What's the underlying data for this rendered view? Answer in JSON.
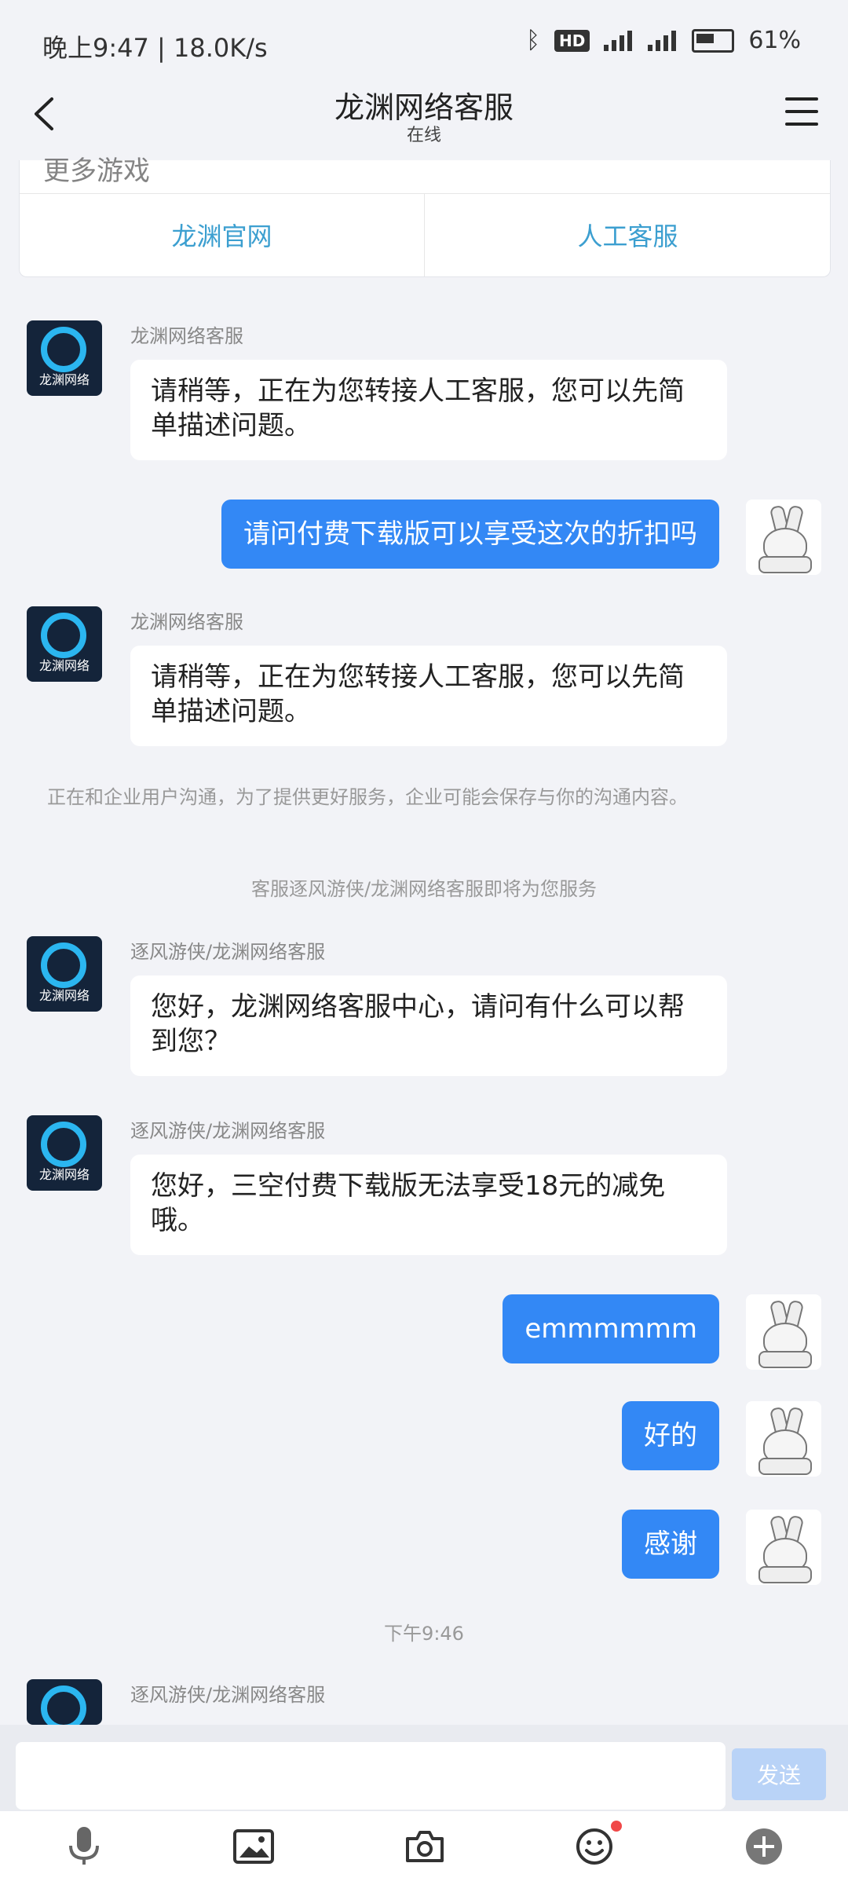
{
  "status_bar": {
    "time": "晚上9:47 | 18.0K/s",
    "hd": "HD",
    "battery": "61%"
  },
  "header": {
    "title": "龙渊网络客服",
    "subtitle": "在线"
  },
  "top_card": {
    "partial_text": "更多游戏",
    "btn_official": "龙渊官网",
    "btn_human": "人工客服"
  },
  "messages": {
    "m1": {
      "sender": "龙渊网络客服",
      "text": "请稍等，正在为您转接人工客服，您可以先简单描述问题。"
    },
    "u1": {
      "text": "请问付费下载版可以享受这次的折扣吗"
    },
    "m2": {
      "sender": "龙渊网络客服",
      "text": "请稍等，正在为您转接人工客服，您可以先简单描述问题。"
    },
    "note": "正在和企业用户沟通，为了提供更好服务，企业可能会保存与你的沟通内容。",
    "transfer": "客服逐风游侠/龙渊网络客服即将为您服务",
    "m3": {
      "sender": "逐风游侠/龙渊网络客服",
      "text": "您好，龙渊网络客服中心，请问有什么可以帮到您？"
    },
    "m4": {
      "sender": "逐风游侠/龙渊网络客服",
      "text": "您好，三空付费下载版无法享受18元的减免哦。"
    },
    "u2": {
      "text": "emmmmmm"
    },
    "u3": {
      "text": "好的"
    },
    "u4": {
      "text": "感谢"
    },
    "time_divider": "下午9:46",
    "m5": {
      "sender": "逐风游侠/龙渊网络客服"
    }
  },
  "bot_avatar_label": "龙渊网络",
  "input": {
    "placeholder": "",
    "send_label": "发送"
  },
  "toolbar": {
    "items": [
      "microphone-icon",
      "image-icon",
      "camera-icon",
      "emoji-icon",
      "plus-icon"
    ],
    "accent": "#3388f5"
  }
}
